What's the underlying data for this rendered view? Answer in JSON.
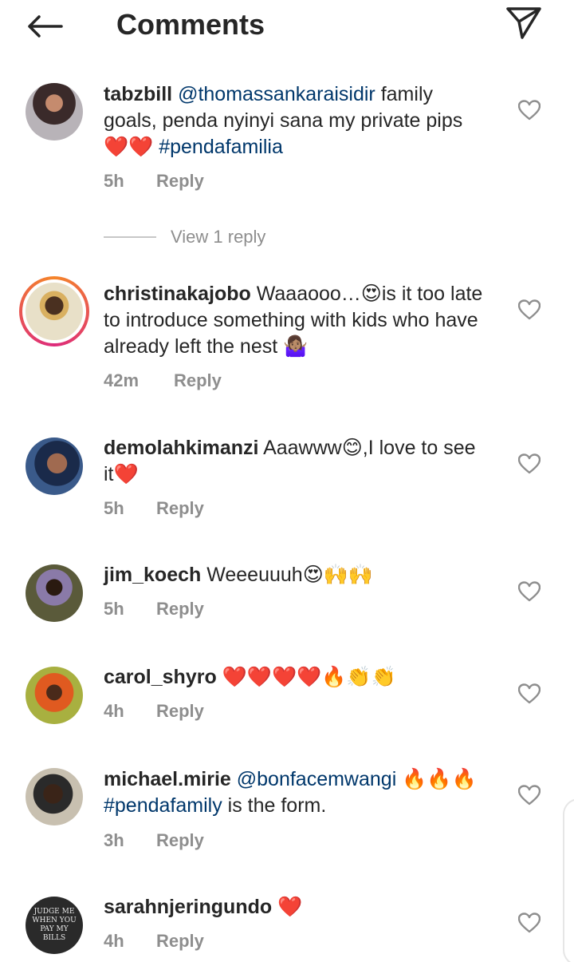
{
  "header": {
    "title": "Comments"
  },
  "colors": {
    "link": "#00376b",
    "muted": "#8e8e8e",
    "heart": "#e0245e"
  },
  "comments": [
    {
      "username": "tabzbill",
      "mention": "@thomassankaraisidir",
      "text_a": " family goals, penda nyinyi sana my private pips",
      "emoji": "❤️❤️",
      "hashtag": " #pendafamilia",
      "time": "5h",
      "reply": "Reply"
    },
    {
      "username": "christinakajobo",
      "text": " Waaaooo…😍is it too late to introduce something with kids who have already left the nest 🤷🏽‍♀️",
      "time": "42m",
      "reply": "Reply"
    },
    {
      "username": "demolahkimanzi",
      "text": " Aaawww😊,I love to see it❤️",
      "time": "5h",
      "reply": "Reply"
    },
    {
      "username": "jim_koech",
      "text": " Weeeuuuh😍🙌🙌",
      "time": "5h",
      "reply": "Reply"
    },
    {
      "username": "carol_shyro",
      "text": " ❤️❤️❤️❤️🔥👏👏",
      "time": "4h",
      "reply": "Reply"
    },
    {
      "username": "michael.mirie",
      "mention": "@bonfacemwangi",
      "text_a": " 🔥🔥🔥",
      "hashtag": "#pendafamily",
      "text_b": " is the form.",
      "time": "3h",
      "reply": "Reply"
    },
    {
      "username": "sarahnjeringundo",
      "text": " ❤️",
      "time": "4h",
      "reply": "Reply"
    }
  ],
  "view_replies": "View 1 reply",
  "avatar_text": "JUDGE ME WHEN YOU PAY MY BILLS"
}
